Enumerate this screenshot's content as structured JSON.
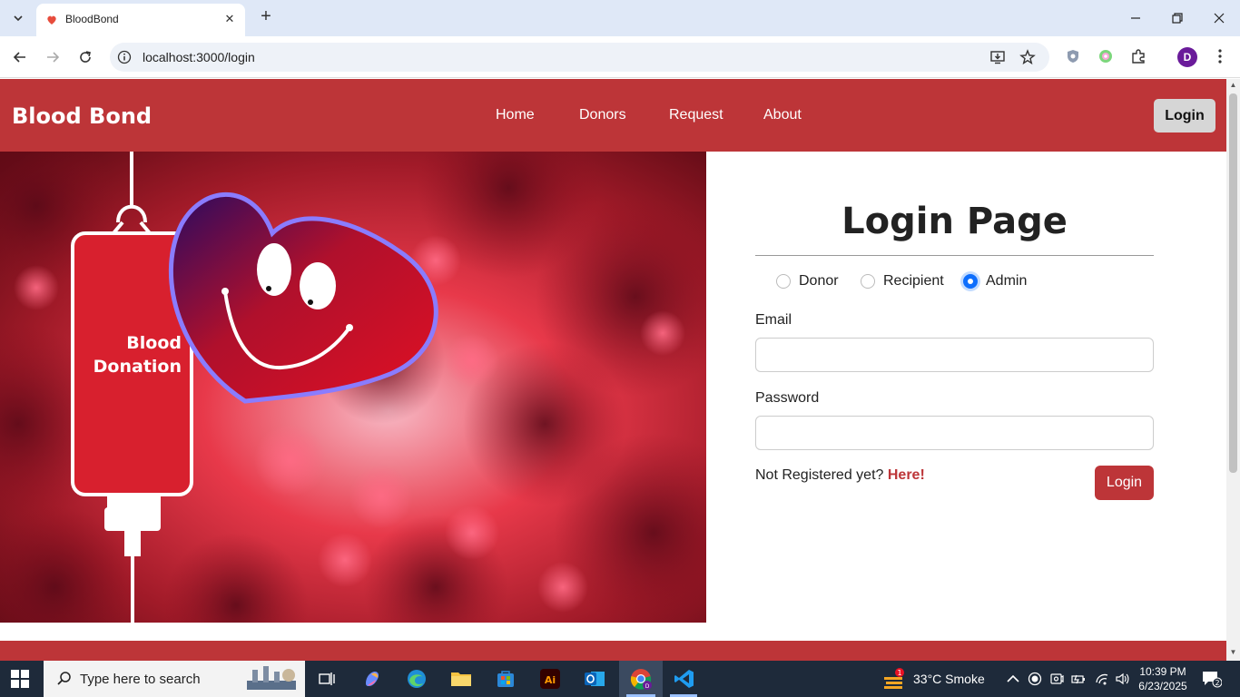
{
  "browser": {
    "tab_title": "BloodBond",
    "url": "localhost:3000/login",
    "profile_initial": "D"
  },
  "site": {
    "brand": "Blood Bond",
    "nav": [
      "Home",
      "Donors",
      "Request",
      "About"
    ],
    "login_button": "Login",
    "accent_color": "#bd3538"
  },
  "hero": {
    "bag_text_line1": "Blood",
    "bag_text_line2": "Donation"
  },
  "login": {
    "title": "Login Page",
    "roles": [
      {
        "label": "Donor",
        "checked": false
      },
      {
        "label": "Recipient",
        "checked": false
      },
      {
        "label": "Admin",
        "checked": true
      }
    ],
    "email_label": "Email",
    "email_value": "",
    "password_label": "Password",
    "password_value": "",
    "register_prompt": "Not Registered yet?",
    "register_link": "Here!",
    "submit_label": "Login"
  },
  "taskbar": {
    "search_placeholder": "Type here to search",
    "weather_badge": "1",
    "weather": "33°C  Smoke",
    "time": "10:39 PM",
    "date": "6/23/2025",
    "notification_count": "2"
  }
}
